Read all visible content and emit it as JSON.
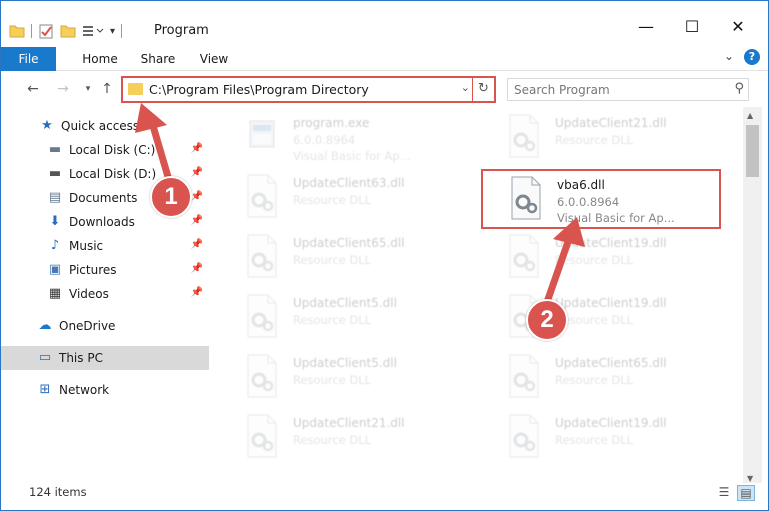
{
  "window": {
    "title": "Program",
    "minimize": "—",
    "maximize": "☐",
    "close": "✕"
  },
  "ribbon": {
    "tabs": [
      "File",
      "Home",
      "Share",
      "View"
    ],
    "expand": "⌄",
    "help": "?"
  },
  "address": {
    "path": "C:\\Program Files\\Program Directory",
    "dropdown": "⌄",
    "refresh": "↻"
  },
  "search": {
    "placeholder": "Search Program"
  },
  "navigation": {
    "items": [
      {
        "label": "Quick access",
        "icon": "star-icon",
        "glyph": "★",
        "color": "#2b6cb8",
        "pinned": false
      },
      {
        "label": "Local Disk (C:)",
        "icon": "drive-icon",
        "glyph": "▬",
        "color": "#6a7a8a",
        "pinned": true
      },
      {
        "label": "Local Disk (D:)",
        "icon": "drive-icon",
        "glyph": "▬",
        "color": "#555",
        "pinned": true
      },
      {
        "label": "Documents",
        "icon": "documents-icon",
        "glyph": "▤",
        "color": "#607890",
        "pinned": true
      },
      {
        "label": "Downloads",
        "icon": "download-icon",
        "glyph": "⬇",
        "color": "#2b6cb8",
        "pinned": true
      },
      {
        "label": "Music",
        "icon": "music-icon",
        "glyph": "♪",
        "color": "#2b6cb8",
        "pinned": true
      },
      {
        "label": "Pictures",
        "icon": "pictures-icon",
        "glyph": "▣",
        "color": "#4a7ab0",
        "pinned": true
      },
      {
        "label": "Videos",
        "icon": "videos-icon",
        "glyph": "▦",
        "color": "#333",
        "pinned": true
      },
      {
        "label": "OneDrive",
        "icon": "cloud-icon",
        "glyph": "☁",
        "color": "#1979ca",
        "pinned": false
      },
      {
        "label": "This PC",
        "icon": "computer-icon",
        "glyph": "▭",
        "color": "#2b6cb8",
        "pinned": false
      },
      {
        "label": "Network",
        "icon": "network-icon",
        "glyph": "⊞",
        "color": "#2b6cb8",
        "pinned": false
      }
    ]
  },
  "files": [
    {
      "name": "program.exe",
      "line1": "6.0.0.8964",
      "line2": "Visual Basic for Ap...",
      "faded": true,
      "highlight": false
    },
    {
      "name": "UpdateClient21.dll",
      "line1": "Resource DLL",
      "line2": "",
      "faded": true,
      "highlight": false
    },
    {
      "name": "UpdateClient63.dll",
      "line1": "Resource DLL",
      "line2": "",
      "faded": true,
      "highlight": false
    },
    {
      "name": "vba6.dll",
      "line1": "6.0.0.8964",
      "line2": "Visual Basic for Ap...",
      "faded": false,
      "highlight": true
    },
    {
      "name": "UpdateClient65.dll",
      "line1": "Resource DLL",
      "line2": "",
      "faded": true,
      "highlight": false
    },
    {
      "name": "UpdateClient19.dll",
      "line1": "Resource DLL",
      "line2": "",
      "faded": true,
      "highlight": false
    },
    {
      "name": "UpdateClient5.dll",
      "line1": "Resource DLL",
      "line2": "",
      "faded": true,
      "highlight": false
    },
    {
      "name": "UpdateClient19.dll",
      "line1": "Resource DLL",
      "line2": "",
      "faded": true,
      "highlight": false
    },
    {
      "name": "UpdateClient5.dll",
      "line1": "Resource DLL",
      "line2": "",
      "faded": true,
      "highlight": false
    },
    {
      "name": "UpdateClient65.dll",
      "line1": "Resource DLL",
      "line2": "",
      "faded": true,
      "highlight": false
    },
    {
      "name": "UpdateClient21.dll",
      "line1": "Resource DLL",
      "line2": "",
      "faded": true,
      "highlight": false
    },
    {
      "name": "UpdateClient19.dll",
      "line1": "Resource DLL",
      "line2": "",
      "faded": true,
      "highlight": false
    }
  ],
  "status": {
    "item_count": "124 items"
  },
  "annotations": {
    "step1": "1",
    "step2": "2",
    "color": "#d9534f"
  }
}
